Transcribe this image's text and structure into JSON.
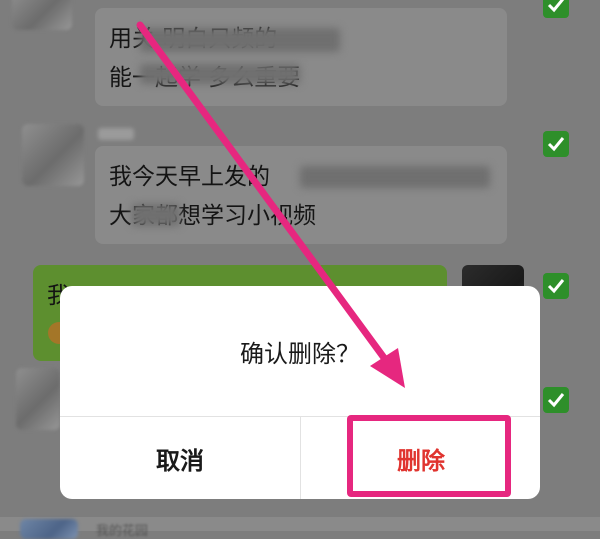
{
  "chat": {
    "message1": {
      "line1": "用关 明白只频的",
      "line2": "能一起学 多么重要"
    },
    "message2": {
      "line1": "我今天早上发的",
      "line2": "大家都想学习小视频"
    },
    "message3": {
      "line1": "我"
    },
    "bottom_text": "我的花园"
  },
  "dialog": {
    "message": "确认删除？",
    "cancel_label": "取消",
    "delete_label": "删除"
  },
  "colors": {
    "accent_delete": "#e0342f",
    "highlight": "#e6277f",
    "check_green": "#2e8f2a"
  },
  "icons": [
    "checkbox-checked-icon",
    "annotation-arrow"
  ]
}
